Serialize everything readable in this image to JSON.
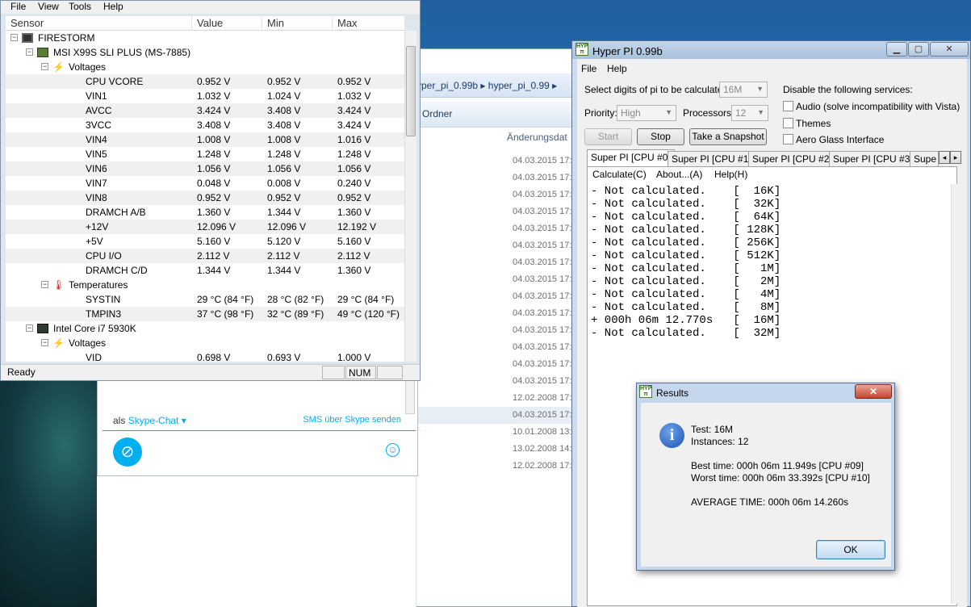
{
  "explorer": {
    "breadcrumb": [
      "yper_pi_0.99b",
      "hyper_pi_0.99"
    ],
    "toolbar_label": "Ordner",
    "column_header": "Änderungsdat",
    "dates": [
      "04.03.2015 17:",
      "04.03.2015 17:",
      "04.03.2015 17:",
      "04.03.2015 17:",
      "04.03.2015 17:",
      "04.03.2015 17:",
      "04.03.2015 17:",
      "04.03.2015 17:",
      "04.03.2015 17:",
      "04.03.2015 17:",
      "04.03.2015 17:",
      "04.03.2015 17:",
      "04.03.2015 17:",
      "04.03.2015 17:",
      "12.02.2008 17:",
      "04.03.2015 17:",
      "10.01.2008 13:",
      "13.02.2008 14:",
      "12.02.2008 17:"
    ]
  },
  "skype": {
    "als_prefix": "als",
    "als_link": "Skype-Chat ▾",
    "sms_link": "SMS über Skype senden"
  },
  "hwmonitor": {
    "menu": [
      "File",
      "View",
      "Tools",
      "Help"
    ],
    "columns": [
      "Sensor",
      "Value",
      "Min",
      "Max"
    ],
    "status": "Ready",
    "num": "NUM",
    "tree": [
      {
        "kind": "node",
        "level": 0,
        "label": "FIRESTORM",
        "icon": "computer-icon"
      },
      {
        "kind": "node",
        "level": 1,
        "label": "MSI X99S SLI PLUS (MS-7885)",
        "icon": "motherboard-icon"
      },
      {
        "kind": "node",
        "level": 2,
        "label": "Voltages",
        "icon": "voltage-icon"
      },
      {
        "kind": "row",
        "name": "CPU VCORE",
        "value": "0.952 V",
        "min": "0.952 V",
        "max": "0.952 V"
      },
      {
        "kind": "row",
        "name": "VIN1",
        "value": "1.032 V",
        "min": "1.024 V",
        "max": "1.032 V"
      },
      {
        "kind": "row",
        "name": "AVCC",
        "value": "3.424 V",
        "min": "3.408 V",
        "max": "3.424 V"
      },
      {
        "kind": "row",
        "name": "3VCC",
        "value": "3.408 V",
        "min": "3.408 V",
        "max": "3.424 V"
      },
      {
        "kind": "row",
        "name": "VIN4",
        "value": "1.008 V",
        "min": "1.008 V",
        "max": "1.016 V"
      },
      {
        "kind": "row",
        "name": "VIN5",
        "value": "1.248 V",
        "min": "1.248 V",
        "max": "1.248 V"
      },
      {
        "kind": "row",
        "name": "VIN6",
        "value": "1.056 V",
        "min": "1.056 V",
        "max": "1.056 V"
      },
      {
        "kind": "row",
        "name": "VIN7",
        "value": "0.048 V",
        "min": "0.008 V",
        "max": "0.240 V"
      },
      {
        "kind": "row",
        "name": "VIN8",
        "value": "0.952 V",
        "min": "0.952 V",
        "max": "0.952 V"
      },
      {
        "kind": "row",
        "name": "DRAMCH A/B",
        "value": "1.360 V",
        "min": "1.344 V",
        "max": "1.360 V"
      },
      {
        "kind": "row",
        "name": "+12V",
        "value": "12.096 V",
        "min": "12.096 V",
        "max": "12.192 V"
      },
      {
        "kind": "row",
        "name": "+5V",
        "value": "5.160 V",
        "min": "5.120 V",
        "max": "5.160 V"
      },
      {
        "kind": "row",
        "name": "CPU I/O",
        "value": "2.112 V",
        "min": "2.112 V",
        "max": "2.112 V"
      },
      {
        "kind": "row",
        "name": "DRAMCH C/D",
        "value": "1.344 V",
        "min": "1.344 V",
        "max": "1.360 V"
      },
      {
        "kind": "node",
        "level": 2,
        "label": "Temperatures",
        "icon": "thermometer-icon"
      },
      {
        "kind": "row",
        "name": "SYSTIN",
        "value": "29 °C  (84 °F)",
        "min": "28 °C  (82 °F)",
        "max": "29 °C  (84 °F)"
      },
      {
        "kind": "row",
        "name": "TMPIN3",
        "value": "37 °C  (98 °F)",
        "min": "32 °C  (89 °F)",
        "max": "49 °C  (120 °F)"
      },
      {
        "kind": "node",
        "level": 1,
        "label": "Intel Core i7 5930K",
        "icon": "cpu-icon"
      },
      {
        "kind": "node",
        "level": 2,
        "label": "Voltages",
        "icon": "voltage-icon"
      },
      {
        "kind": "row",
        "name": "VID",
        "value": "0.698 V",
        "min": "0.693 V",
        "max": "1.000 V"
      }
    ]
  },
  "hyperpi": {
    "title": "Hyper PI 0.99b",
    "menu": [
      "File",
      "Help"
    ],
    "digits_label": "Select digits of pi to be calculated:",
    "digits_value": "16M",
    "priority_label": "Priority:",
    "priority_value": "High",
    "processors_label": "Processors:",
    "processors_value": "12",
    "services_label": "Disable the following services:",
    "services": [
      "Audio (solve incompatibility with Vista)",
      "Themes",
      "Aero Glass Interface"
    ],
    "start_label": "Start",
    "stop_label": "Stop",
    "snapshot_label": "Take a Snapshot",
    "tabs": [
      "Super PI [CPU #0]",
      "Super PI [CPU #1]",
      "Super PI [CPU #2]",
      "Super PI [CPU #3]",
      "Supe"
    ],
    "pane_menu": [
      "Calculate(C)",
      "About...(A)",
      "Help(H)"
    ],
    "output": [
      "- Not calculated.    [  16K]",
      "- Not calculated.    [  32K]",
      "- Not calculated.    [  64K]",
      "- Not calculated.    [ 128K]",
      "- Not calculated.    [ 256K]",
      "- Not calculated.    [ 512K]",
      "- Not calculated.    [   1M]",
      "- Not calculated.    [   2M]",
      "- Not calculated.    [   4M]",
      "- Not calculated.    [   8M]",
      "+ 000h 06m 12.770s   [  16M]",
      "- Not calculated.    [  32M]"
    ]
  },
  "results": {
    "title": "Results",
    "test": "Test: 16M",
    "instances": "Instances: 12",
    "best": "Best time: 000h 06m 11.949s [CPU #09]",
    "worst": "Worst time: 000h 06m 33.392s [CPU #10]",
    "average": "AVERAGE TIME: 000h 06m 14.260s",
    "ok_label": "OK"
  }
}
